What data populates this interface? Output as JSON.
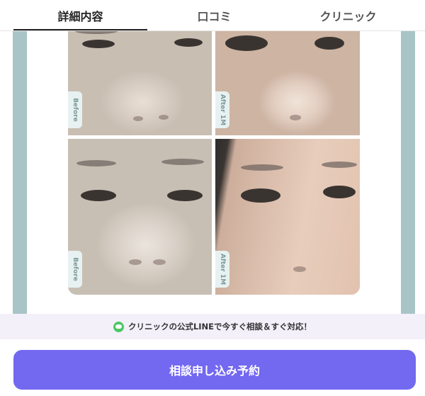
{
  "tabs": {
    "items": [
      {
        "label": "詳細内容",
        "active": true
      },
      {
        "label": "口コミ",
        "active": false
      },
      {
        "label": "クリニック",
        "active": false
      }
    ]
  },
  "gallery": {
    "photos": [
      {
        "label": "Before"
      },
      {
        "label": "After 1M"
      },
      {
        "label": "Before"
      },
      {
        "label": "After 1M"
      }
    ]
  },
  "notice": {
    "icon": "line-chat-icon",
    "text": "クリニックの公式LINEで今すぐ相談＆すぐ対応！"
  },
  "cta": {
    "label": "相談申し込み予約"
  },
  "colors": {
    "accent": "#7368f0",
    "line_green": "#4cc764",
    "frame": "#a9c4c7"
  }
}
